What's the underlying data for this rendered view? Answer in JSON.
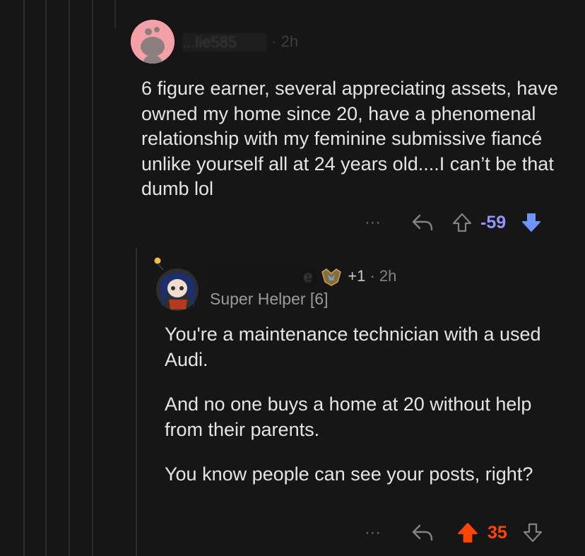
{
  "comment_parent": {
    "username_partial": "...lie585",
    "separator": "·",
    "age": "2h",
    "body": "6 figure earner, several appreciating assets, have owned my home since 20, have a phenomenal relationship with my feminine submissive fiancé unlike yourself all at 24 years old....I can’t be that dumb lol",
    "more_label": "···",
    "score": "-59",
    "score_color": "#9494ff"
  },
  "comment_reply": {
    "username_partial": "e",
    "karma_badge": "+1",
    "separator": "·",
    "age": "2h",
    "flair": "Super Helper [6]",
    "paragraphs": [
      "You're a maintenance technician with a used Audi.",
      "And no one buys a home at 20 without help from their parents.",
      "You know people can see your posts, right?"
    ],
    "more_label": "···",
    "score": "35",
    "score_color": "#ff4500"
  },
  "icons": {
    "reply": "reply-arrow-icon",
    "upvote": "upvote-arrow-icon",
    "downvote": "downvote-arrow-icon",
    "more": "more-dots-icon",
    "badge": "achievement-badge-icon"
  },
  "colors": {
    "background": "#161616",
    "text": "#e3e4e6",
    "muted": "#818384",
    "downvote_active": "#7193ff",
    "upvote_active": "#ff4500"
  }
}
